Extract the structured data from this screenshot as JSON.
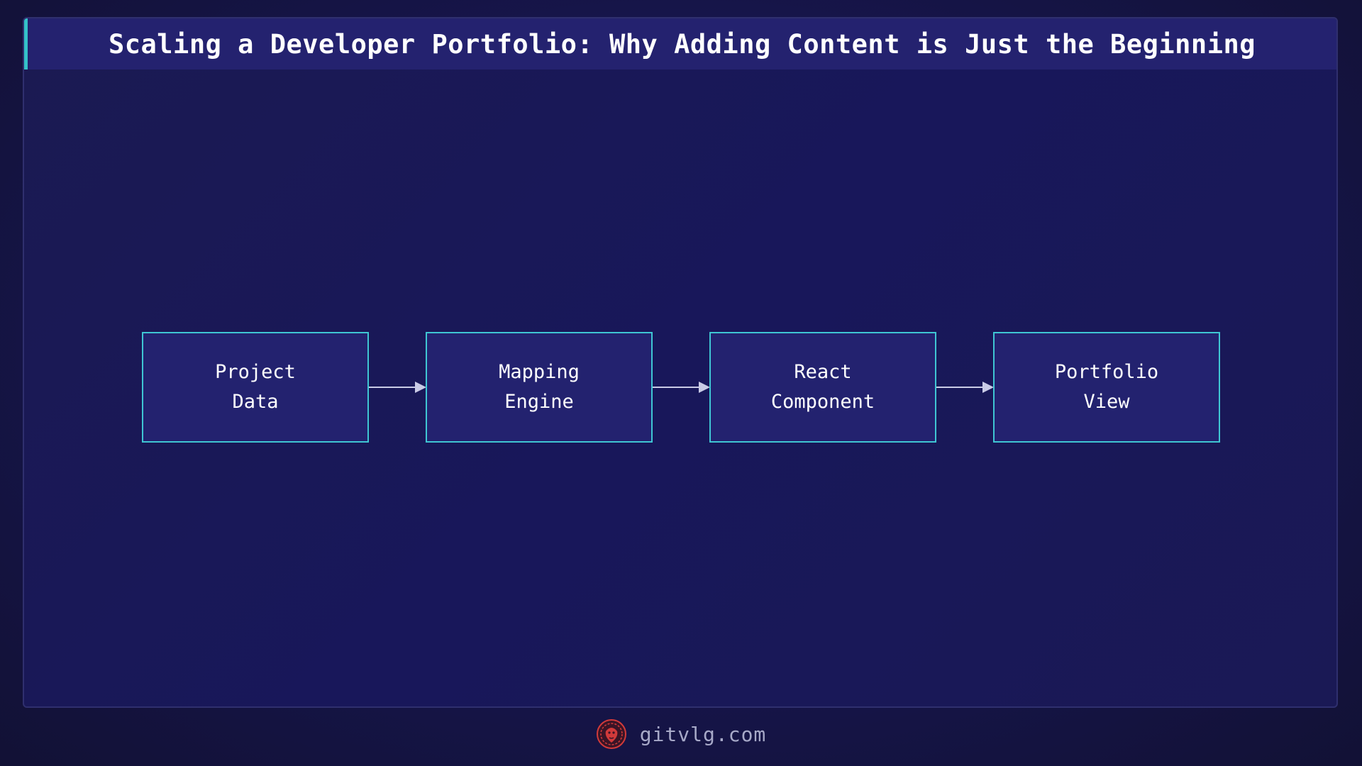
{
  "title": "Scaling a Developer Portfolio: Why Adding Content is Just the Beginning",
  "diagram": {
    "nodes": [
      {
        "label": "Project\nData"
      },
      {
        "label": "Mapping\nEngine"
      },
      {
        "label": "React\nComponent"
      },
      {
        "label": "Portfolio\nView"
      }
    ],
    "edges": [
      {
        "from": 0,
        "to": 1
      },
      {
        "from": 1,
        "to": 2
      },
      {
        "from": 2,
        "to": 3
      }
    ]
  },
  "footer": {
    "site": "gitvlg.com",
    "logo_icon": "lion-logo-icon"
  },
  "colors": {
    "background": "#16154a",
    "title_bar": "#24226f",
    "accent": "#3fc6d3",
    "node_fill": "#23226f",
    "arrow": "#c9cbe6",
    "logo": "#d23a3a"
  }
}
